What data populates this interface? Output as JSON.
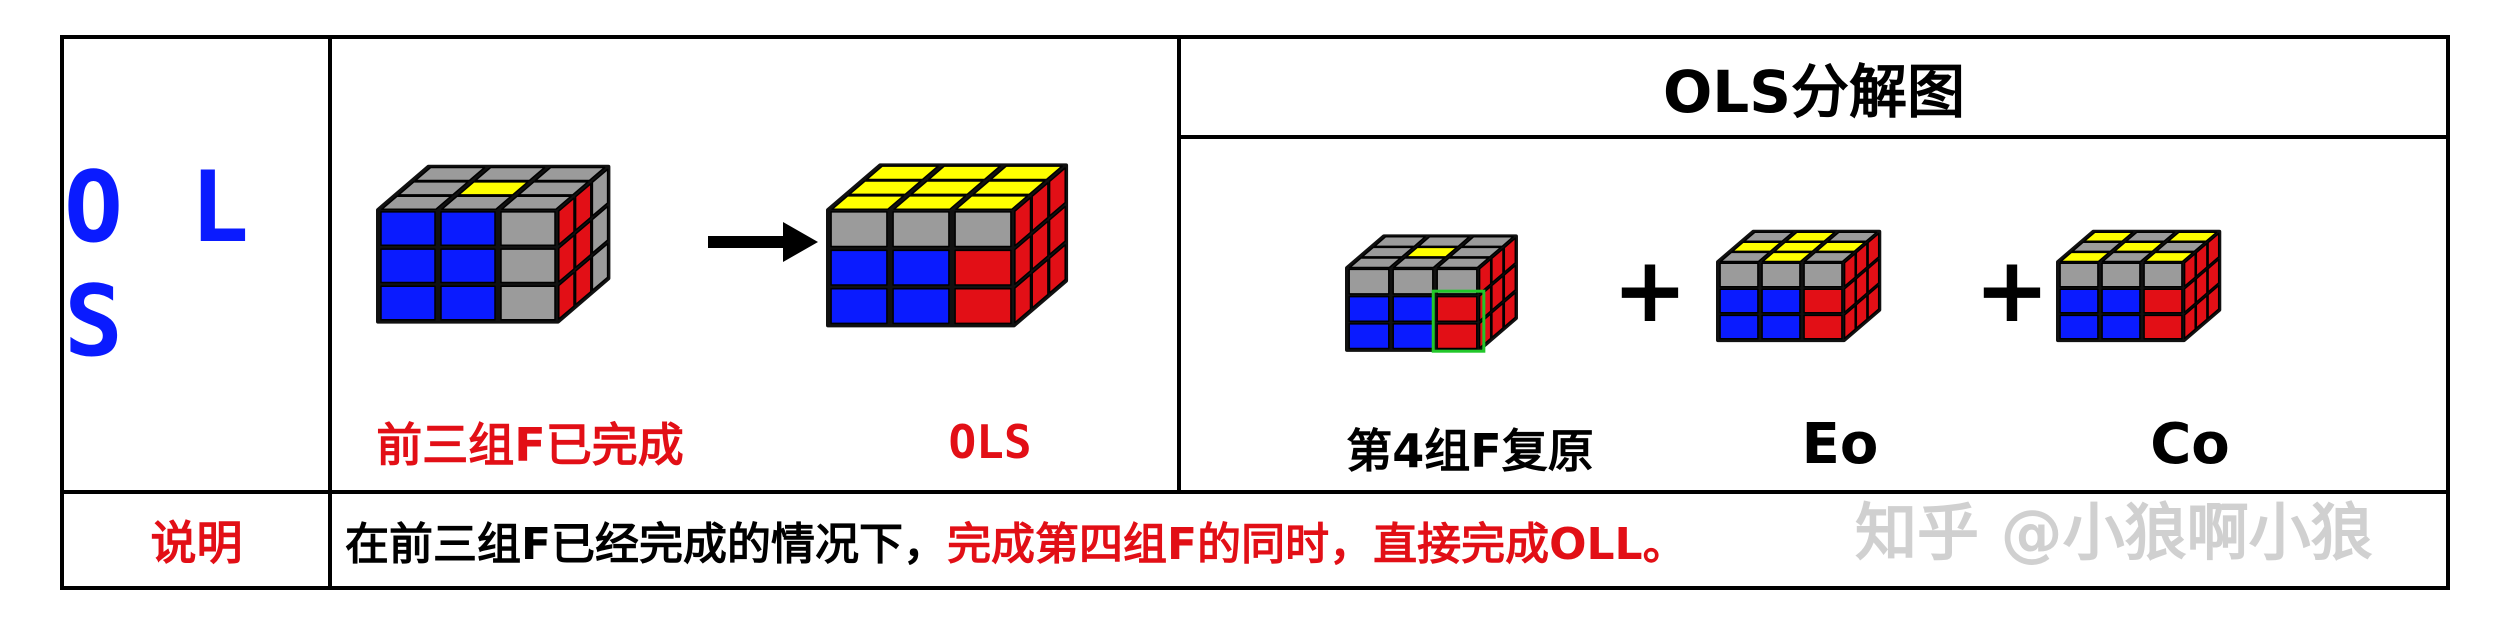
{
  "left_title": "O L S",
  "top_right_header": "OLS分解图",
  "left_cube_caption": "前三组F已完成",
  "right_cube_caption": "OLS",
  "decomp": {
    "caption1": "第4组F复原",
    "caption2": "Eo",
    "caption3": "Co",
    "plus": "+"
  },
  "bottom": {
    "label": "说明",
    "text_black": "在前三组F已经完成的情况下，",
    "text_red": "完成第四组F的同时，直接完成OLL。"
  },
  "watermark": "知乎 @小狼啊小狼",
  "colors": {
    "blue": "#0a1bff",
    "red": "#e20f16",
    "yellow": "#ffff00",
    "gray": "#9b9b9b",
    "outline": "#111111",
    "green": "#22c72a"
  }
}
